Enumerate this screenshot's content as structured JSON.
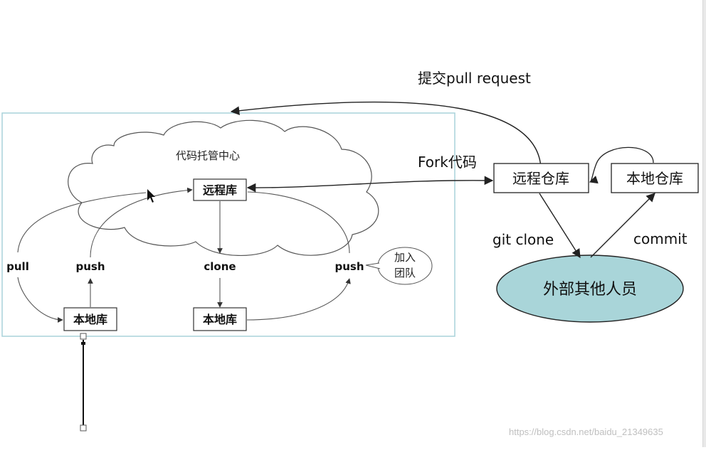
{
  "cloud_title": "代码托管中心",
  "boxes": {
    "remote_repo_in_cloud": "远程库",
    "local_repo_left": "本地库",
    "local_repo_center": "本地库",
    "remote_repository_right": "远程仓库",
    "local_repository_right": "本地仓库"
  },
  "ellipse": "外部其他人员",
  "labels": {
    "pull": "pull",
    "push_left": "push",
    "clone_center": "clone",
    "push_right": "push",
    "join_team_line1": "加入",
    "join_team_line2": "团队",
    "pull_request": "提交pull request",
    "fork_code": "Fork代码",
    "git_clone": "git clone",
    "commit": "commit"
  },
  "watermark": "https://blog.csdn.net/baidu_21349635",
  "colors": {
    "frame_border": "#a9d2da",
    "ellipse_fill": "#a9d5d9",
    "stroke": "#333333"
  }
}
